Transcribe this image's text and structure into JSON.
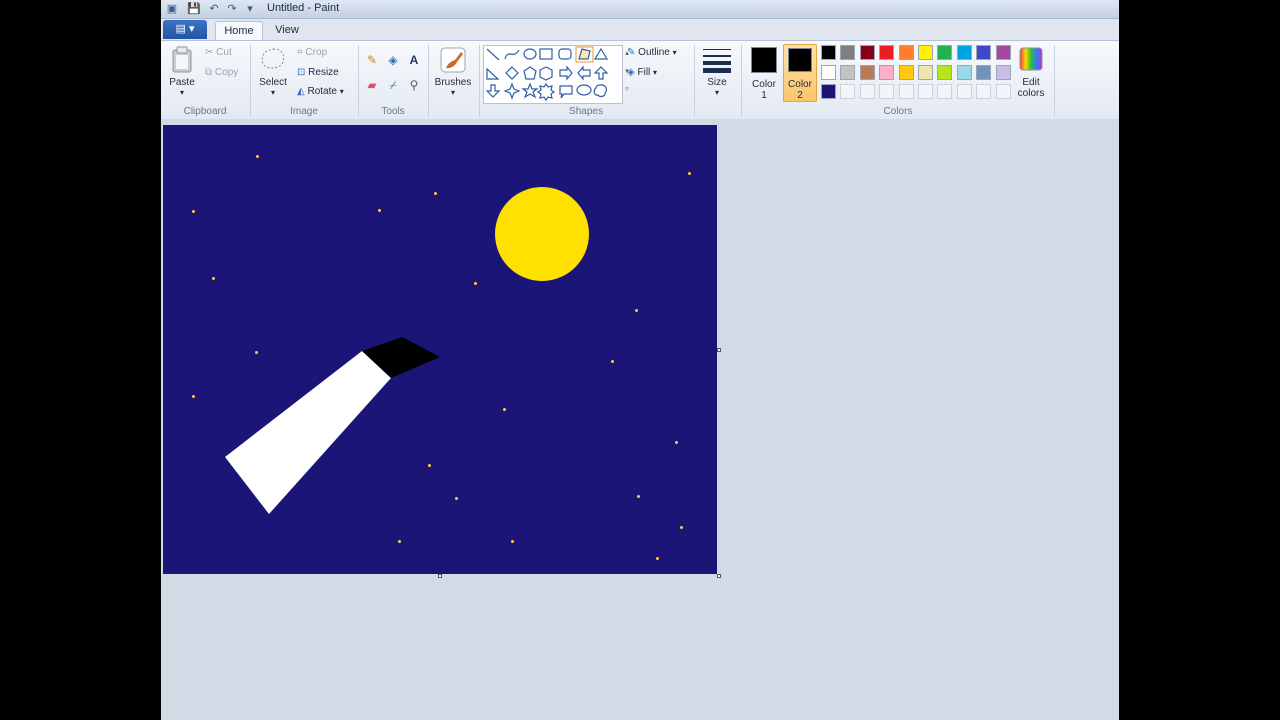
{
  "window": {
    "title": "Untitled - Paint"
  },
  "tabs": {
    "file": "▤ ▾",
    "home": "Home",
    "view": "View"
  },
  "clipboard": {
    "group_label": "Clipboard",
    "paste": "Paste",
    "cut": "Cut",
    "copy": "Copy"
  },
  "image": {
    "group_label": "Image",
    "select": "Select",
    "crop": "Crop",
    "resize": "Resize",
    "rotate": "Rotate"
  },
  "tools": {
    "group_label": "Tools"
  },
  "brushes": {
    "label": "Brushes"
  },
  "shapes": {
    "group_label": "Shapes",
    "outline": "Outline",
    "fill": "Fill"
  },
  "size": {
    "label": "Size"
  },
  "colors": {
    "group_label": "Colors",
    "color1_label_a": "Color",
    "color1_label_b": "1",
    "color2_label_a": "Color",
    "color2_label_b": "2",
    "color1": "#000000",
    "color2": "#000000",
    "edit_a": "Edit",
    "edit_b": "colors",
    "palette_row1": [
      "#000000",
      "#7f7f7f",
      "#880015",
      "#ed1c24",
      "#ff7f27",
      "#fff200",
      "#22b14c",
      "#00a2e8",
      "#3f48cc",
      "#a349a4"
    ],
    "palette_row2": [
      "#ffffff",
      "#c3c3c3",
      "#b97a57",
      "#ffaec9",
      "#ffc90e",
      "#efe4b0",
      "#b5e61d",
      "#99d9ea",
      "#7092be",
      "#c8bfe7"
    ],
    "palette_row3": [
      "#1a1577"
    ]
  },
  "canvas": {
    "background": "#1a1577",
    "moon_color": "#ffe100",
    "star_color": "#ffcc33"
  }
}
